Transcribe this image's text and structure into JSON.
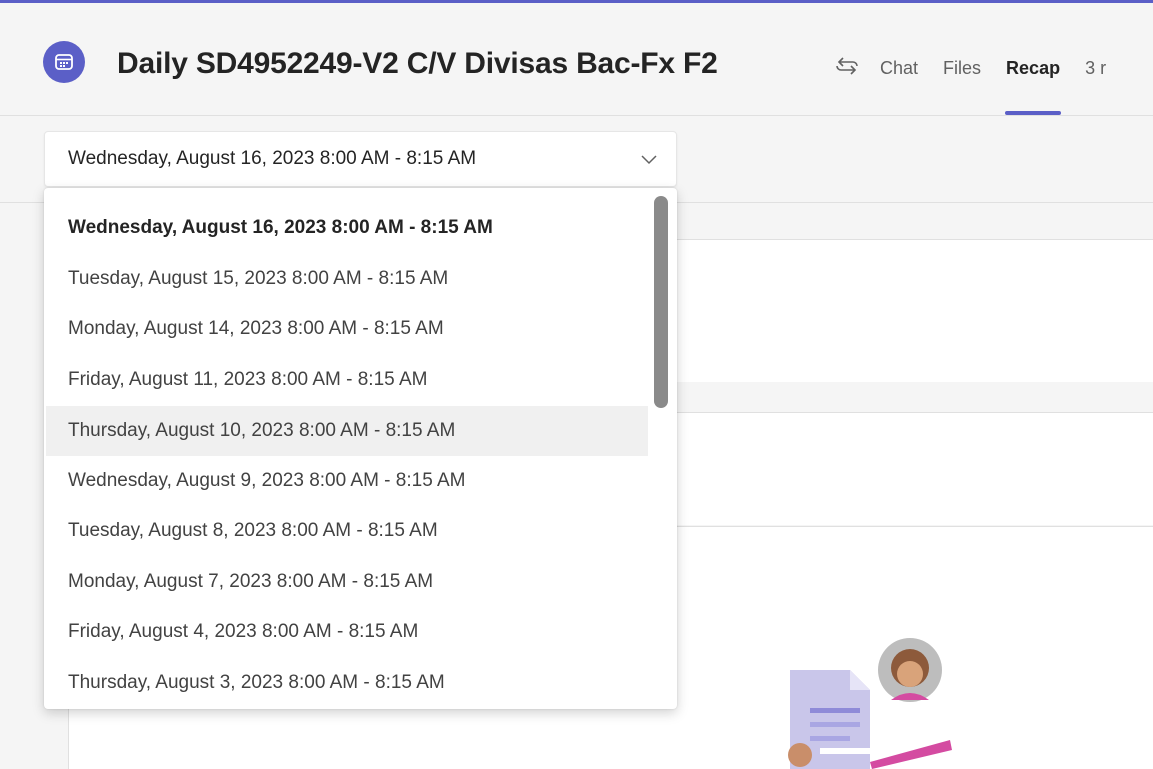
{
  "header": {
    "title": "Daily SD4952249-V2 C/V Divisas Bac-Fx F2",
    "tabs": [
      {
        "label": "Chat",
        "active": false
      },
      {
        "label": "Files",
        "active": false
      },
      {
        "label": "Recap",
        "active": true
      },
      {
        "label": "3 r",
        "active": false
      }
    ],
    "icons": {
      "meeting": "calendar-icon",
      "recurring": "recurring-icon"
    }
  },
  "occurrence_select": {
    "selected_value": "Wednesday, August 16, 2023 8:00 AM - 8:15 AM",
    "options": [
      "Wednesday, August 16, 2023 8:00 AM - 8:15 AM",
      "Tuesday, August 15, 2023 8:00 AM - 8:15 AM",
      "Monday, August 14, 2023 8:00 AM - 8:15 AM",
      "Friday, August 11, 2023 8:00 AM - 8:15 AM",
      "Thursday, August 10, 2023 8:00 AM - 8:15 AM",
      "Wednesday, August 9, 2023 8:00 AM - 8:15 AM",
      "Tuesday, August 8, 2023 8:00 AM - 8:15 AM",
      "Monday, August 7, 2023 8:00 AM - 8:15 AM",
      "Friday, August 4, 2023 8:00 AM - 8:15 AM",
      "Thursday, August 3, 2023 8:00 AM - 8:15 AM"
    ],
    "selected_index": 0,
    "hovered_index": 4
  },
  "colors": {
    "accent": "#5b5fc7",
    "background": "#f5f5f5",
    "text": "#242424"
  }
}
